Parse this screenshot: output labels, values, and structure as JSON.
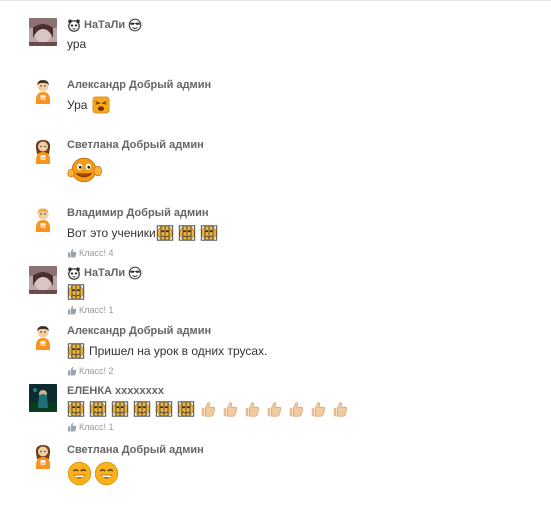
{
  "comments": [
    {
      "author": "НаТаЛи",
      "text": "ура"
    },
    {
      "author": "Александр Добрый админ",
      "text": "Ура"
    },
    {
      "author": "Светлана Добрый админ",
      "text": ""
    },
    {
      "author": "Владимир Добрый админ",
      "text": "Вот это ученики",
      "likes": "Класс! 4"
    },
    {
      "author": "НаТаЛи",
      "text": "",
      "likes": "Класс! 1"
    },
    {
      "author": "Александр Добрый админ",
      "text": "Пришел на урок в одних трусах.",
      "likes": "Класс! 2"
    },
    {
      "author": "ЕЛЕНКА xxxxxxxx",
      "text": "",
      "likes": "Класс! 1"
    },
    {
      "author": "Светлана Добрый админ",
      "text": ""
    }
  ],
  "icons": {
    "like": "thumb-up-icon",
    "cage_smiley": "caged-smiley-icon",
    "thumbs": "thumbs-up-emoji-icon",
    "grin": "grinning-smiley-icon",
    "waving": "waving-smiley-icon",
    "surprised": "surprised-smiley-icon",
    "panda": "panda-emoji-icon",
    "cool": "sunglasses-emoji-icon"
  },
  "colors": {
    "author": "#666666",
    "text": "#333333",
    "meta": "#999999",
    "smiley": "#f7a81b"
  }
}
